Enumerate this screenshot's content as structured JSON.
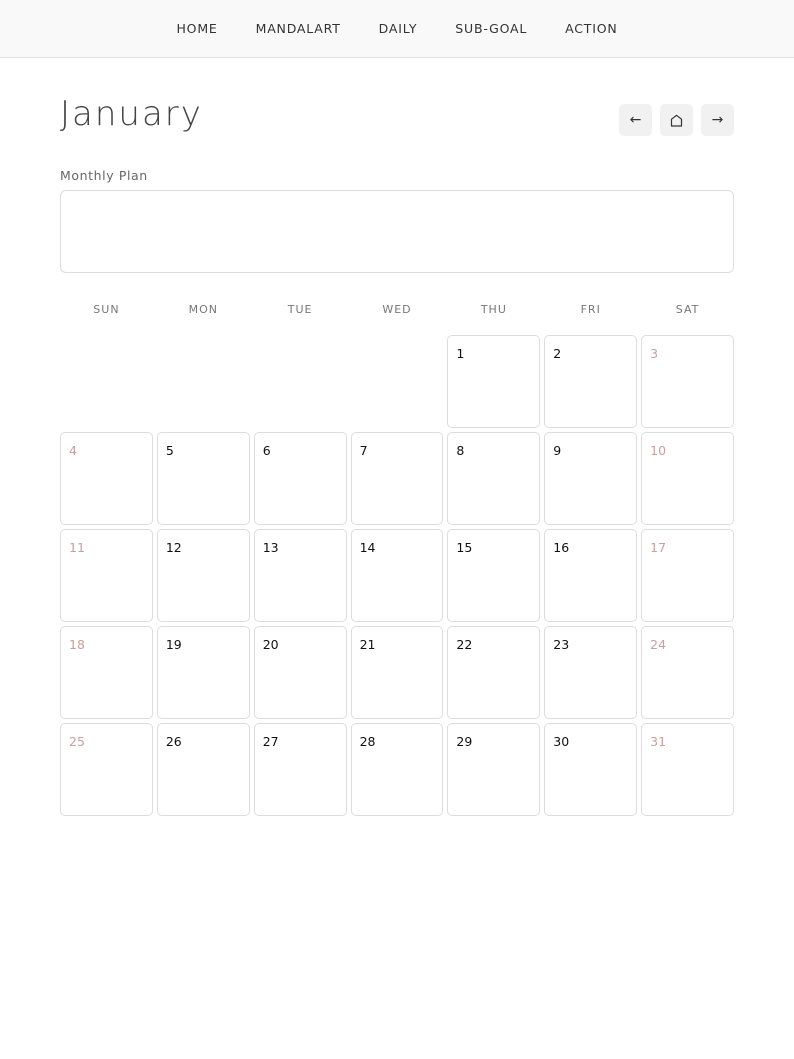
{
  "nav": {
    "items": [
      "HOME",
      "MANDALART",
      "DAILY",
      "SUB-GOAL",
      "ACTION"
    ]
  },
  "header": {
    "month": "January",
    "controls": {
      "prev_label": "←",
      "home_icon": "home-icon",
      "next_label": "→"
    }
  },
  "plan": {
    "label": "Monthly Plan",
    "value": ""
  },
  "calendar": {
    "weekdays": [
      "SUN",
      "MON",
      "TUE",
      "WED",
      "THU",
      "FRI",
      "SAT"
    ],
    "first_weekday_index": 4,
    "days_in_month": 31,
    "weekend_color": "#c9a09c",
    "day_color": "#111111"
  }
}
